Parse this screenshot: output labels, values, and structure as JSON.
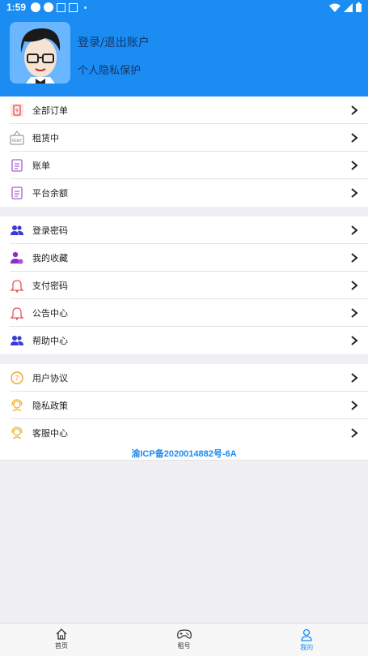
{
  "status_bar": {
    "time": "1:59"
  },
  "header": {
    "login_text": "登录/退出账户",
    "privacy_text": "个人隐私保护"
  },
  "group1": [
    {
      "label": "全部订单",
      "icon": "order-icon"
    },
    {
      "label": "租赁中",
      "icon": "rent-icon"
    },
    {
      "label": "账单",
      "icon": "bill-icon"
    },
    {
      "label": "平台余额",
      "icon": "balance-icon"
    }
  ],
  "group2": [
    {
      "label": "登录密码",
      "icon": "users-icon"
    },
    {
      "label": "我的收藏",
      "icon": "user-favorite-icon"
    },
    {
      "label": "支付密码",
      "icon": "bell-icon"
    },
    {
      "label": "公告中心",
      "icon": "bell-icon"
    },
    {
      "label": "帮助中心",
      "icon": "users-icon"
    }
  ],
  "group3": [
    {
      "label": "用户协议",
      "icon": "question-icon"
    },
    {
      "label": "隐私政策",
      "icon": "support-icon"
    },
    {
      "label": "客服中心",
      "icon": "support-icon"
    }
  ],
  "icp": "渝ICP备2020014882号-6A",
  "tabbar": [
    {
      "label": "首页",
      "icon": "home-icon"
    },
    {
      "label": "租号",
      "icon": "gamepad-icon"
    },
    {
      "label": "我的",
      "icon": "profile-icon",
      "active": true
    }
  ],
  "colors": {
    "primary": "#1a8cf2",
    "background": "#efeff4"
  }
}
